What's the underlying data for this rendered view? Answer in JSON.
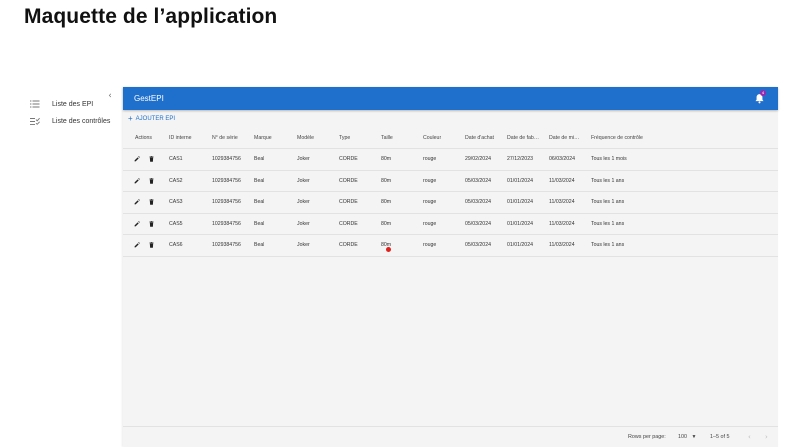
{
  "page": {
    "title": "Maquette de l’application"
  },
  "sidebar": {
    "collapse_icon": "chevron-left-icon",
    "items": [
      {
        "label": "Liste des EPI",
        "icon": "list-icon"
      },
      {
        "label": "Liste des contrôles",
        "icon": "checklist-icon"
      }
    ]
  },
  "appbar": {
    "title": "GestEPI",
    "color": "#1f6fcc",
    "notification_count": "4"
  },
  "toolbar": {
    "add_label": "AJOUTER EPI"
  },
  "table": {
    "columns": [
      "Actions",
      "ID interne",
      "N° de série",
      "Marque",
      "Modèle",
      "Type",
      "Taille",
      "Couleur",
      "Date d'achat",
      "Date de fab…",
      "Date de mi…",
      "Fréquence de contrôle"
    ],
    "rows": [
      [
        "CAS1",
        "1029384756",
        "Beal",
        "Joker",
        "CORDE",
        "80m",
        "rouge",
        "29/02/2024",
        "27/12/2023",
        "06/03/2024",
        "Tous les 1 mois"
      ],
      [
        "CAS2",
        "1029384756",
        "Beal",
        "Joker",
        "CORDE",
        "80m",
        "rouge",
        "05/03/2024",
        "01/01/2024",
        "11/03/2024",
        "Tous les 1 ans"
      ],
      [
        "CAS3",
        "1029384756",
        "Beal",
        "Joker",
        "CORDE",
        "80m",
        "rouge",
        "05/03/2024",
        "01/01/2024",
        "11/03/2024",
        "Tous les 1 ans"
      ],
      [
        "CAS5",
        "1029384756",
        "Beal",
        "Joker",
        "CORDE",
        "80m",
        "rouge",
        "05/03/2024",
        "01/01/2024",
        "11/03/2024",
        "Tous les 1 ans"
      ],
      [
        "CAS6",
        "1029384756",
        "Beal",
        "Joker",
        "CORDE",
        "80m",
        "rouge",
        "05/03/2024",
        "01/01/2024",
        "11/03/2024",
        "Tous les 1 ans"
      ]
    ]
  },
  "pagination": {
    "rows_per_page_label": "Rows per page:",
    "rows_per_page_value": "100",
    "range": "1–5 of 5"
  }
}
